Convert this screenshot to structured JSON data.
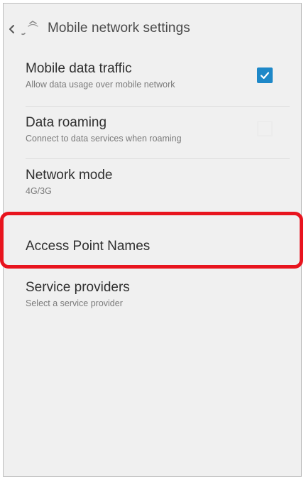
{
  "app_bar": {
    "title": "Mobile network settings",
    "back_icon": "back-arrow-app-icon"
  },
  "settings": [
    {
      "title": "Mobile data traffic",
      "subtitle": "Allow data usage over mobile network",
      "control": "checkbox",
      "checked": true
    },
    {
      "title": "Data roaming",
      "subtitle": "Connect to data services when roaming",
      "control": "checkbox",
      "checked": false
    },
    {
      "title": "Network mode",
      "subtitle": "4G/3G"
    },
    {
      "title": "Access Point Names"
    },
    {
      "title": "Service providers",
      "subtitle": "Select a service provider",
      "highlighted": true
    }
  ],
  "colors": {
    "accent": "#1e88c8",
    "highlight": "#e8141e",
    "background": "#f0f0f0"
  }
}
